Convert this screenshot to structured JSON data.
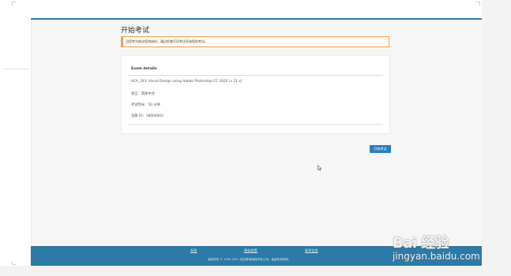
{
  "page": {
    "title": "开始考试",
    "notice": "当您考为每次您终始时，通过检查打印考试开始您的考试。"
  },
  "exam": {
    "heading": "Exam details",
    "name": "ACA_103: Visual Design using Adobe Photoshop CC 2020 (v 21.x)",
    "language": "语言：简体中文",
    "duration": "考试时长：50 分钟",
    "registration": "注册 ID：38604003"
  },
  "actions": {
    "start_label": "开始考试"
  },
  "footer": {
    "links": [
      "条款",
      "隐私政策",
      "联系信息"
    ],
    "copyright": "版权所有 © 1999-2021 培生教育版权所有公司。保留所有权利。"
  },
  "watermark": {
    "logo": "Bai 经验",
    "url": "jingyan.baidu.com"
  },
  "colors": {
    "accent": "#2b7fbf",
    "footer": "#2b7aa8",
    "notice_border": "#f0a050"
  }
}
